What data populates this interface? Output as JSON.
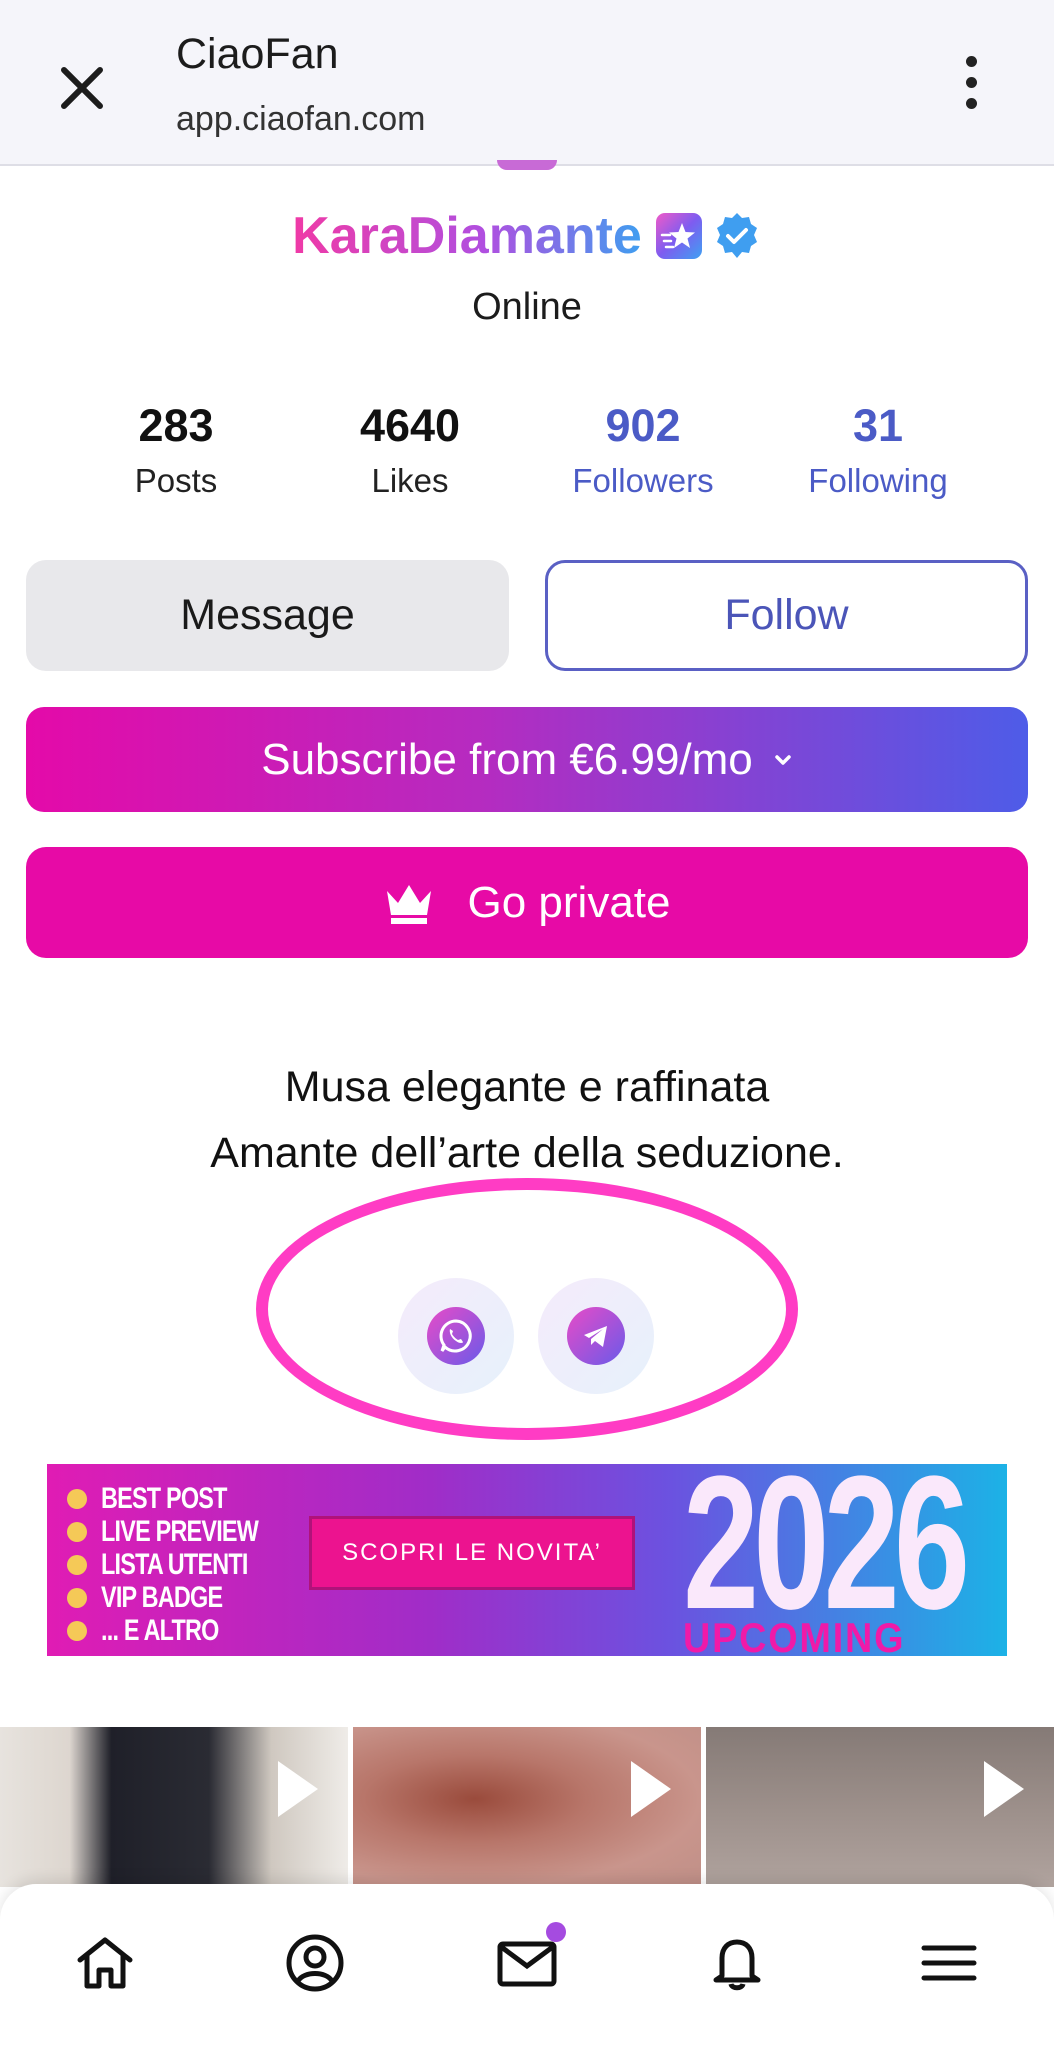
{
  "browser": {
    "title": "CiaoFan",
    "url": "app.ciaofan.com",
    "close_icon": "close-icon",
    "menu_icon": "more-vertical-icon"
  },
  "profile": {
    "username": "KaraDiamante",
    "status": "Online",
    "badges": [
      "star-badge-icon",
      "verified-icon"
    ],
    "colors": {
      "name_gradient_start": "#f03aa6",
      "name_gradient_end": "#3f9ef0",
      "verified": "#3f9ef0"
    }
  },
  "stats": [
    {
      "value": "283",
      "label": "Posts"
    },
    {
      "value": "4640",
      "label": "Likes"
    },
    {
      "value": "902",
      "label": "Followers"
    },
    {
      "value": "31",
      "label": "Following"
    }
  ],
  "actions": {
    "message_label": "Message",
    "follow_label": "Follow",
    "subscribe_label": "Subscribe from €6.99/mo",
    "private_label": "Go private"
  },
  "bio": {
    "line1": "Musa elegante e raffinata",
    "line2": "Amante dell’arte della seduzione."
  },
  "social": [
    "whatsapp-icon",
    "telegram-icon"
  ],
  "banner": {
    "items": [
      "BEST POST",
      "LIVE PREVIEW",
      "LISTA UTENTI",
      "VIP BADGE",
      "... E ALTRO"
    ],
    "cta": "SCOPRI LE NOVITA’",
    "year": "2026",
    "tag": "UPCOMING"
  },
  "media_thumbnails": [
    "video",
    "video",
    "video"
  ],
  "bottom_nav": [
    "home-icon",
    "profile-icon",
    "mail-icon",
    "bell-icon",
    "menu-icon"
  ],
  "colors": {
    "accent_pink": "#e70aa6",
    "accent_blue": "#4b5bc6",
    "highlight": "#ff3cc4"
  }
}
